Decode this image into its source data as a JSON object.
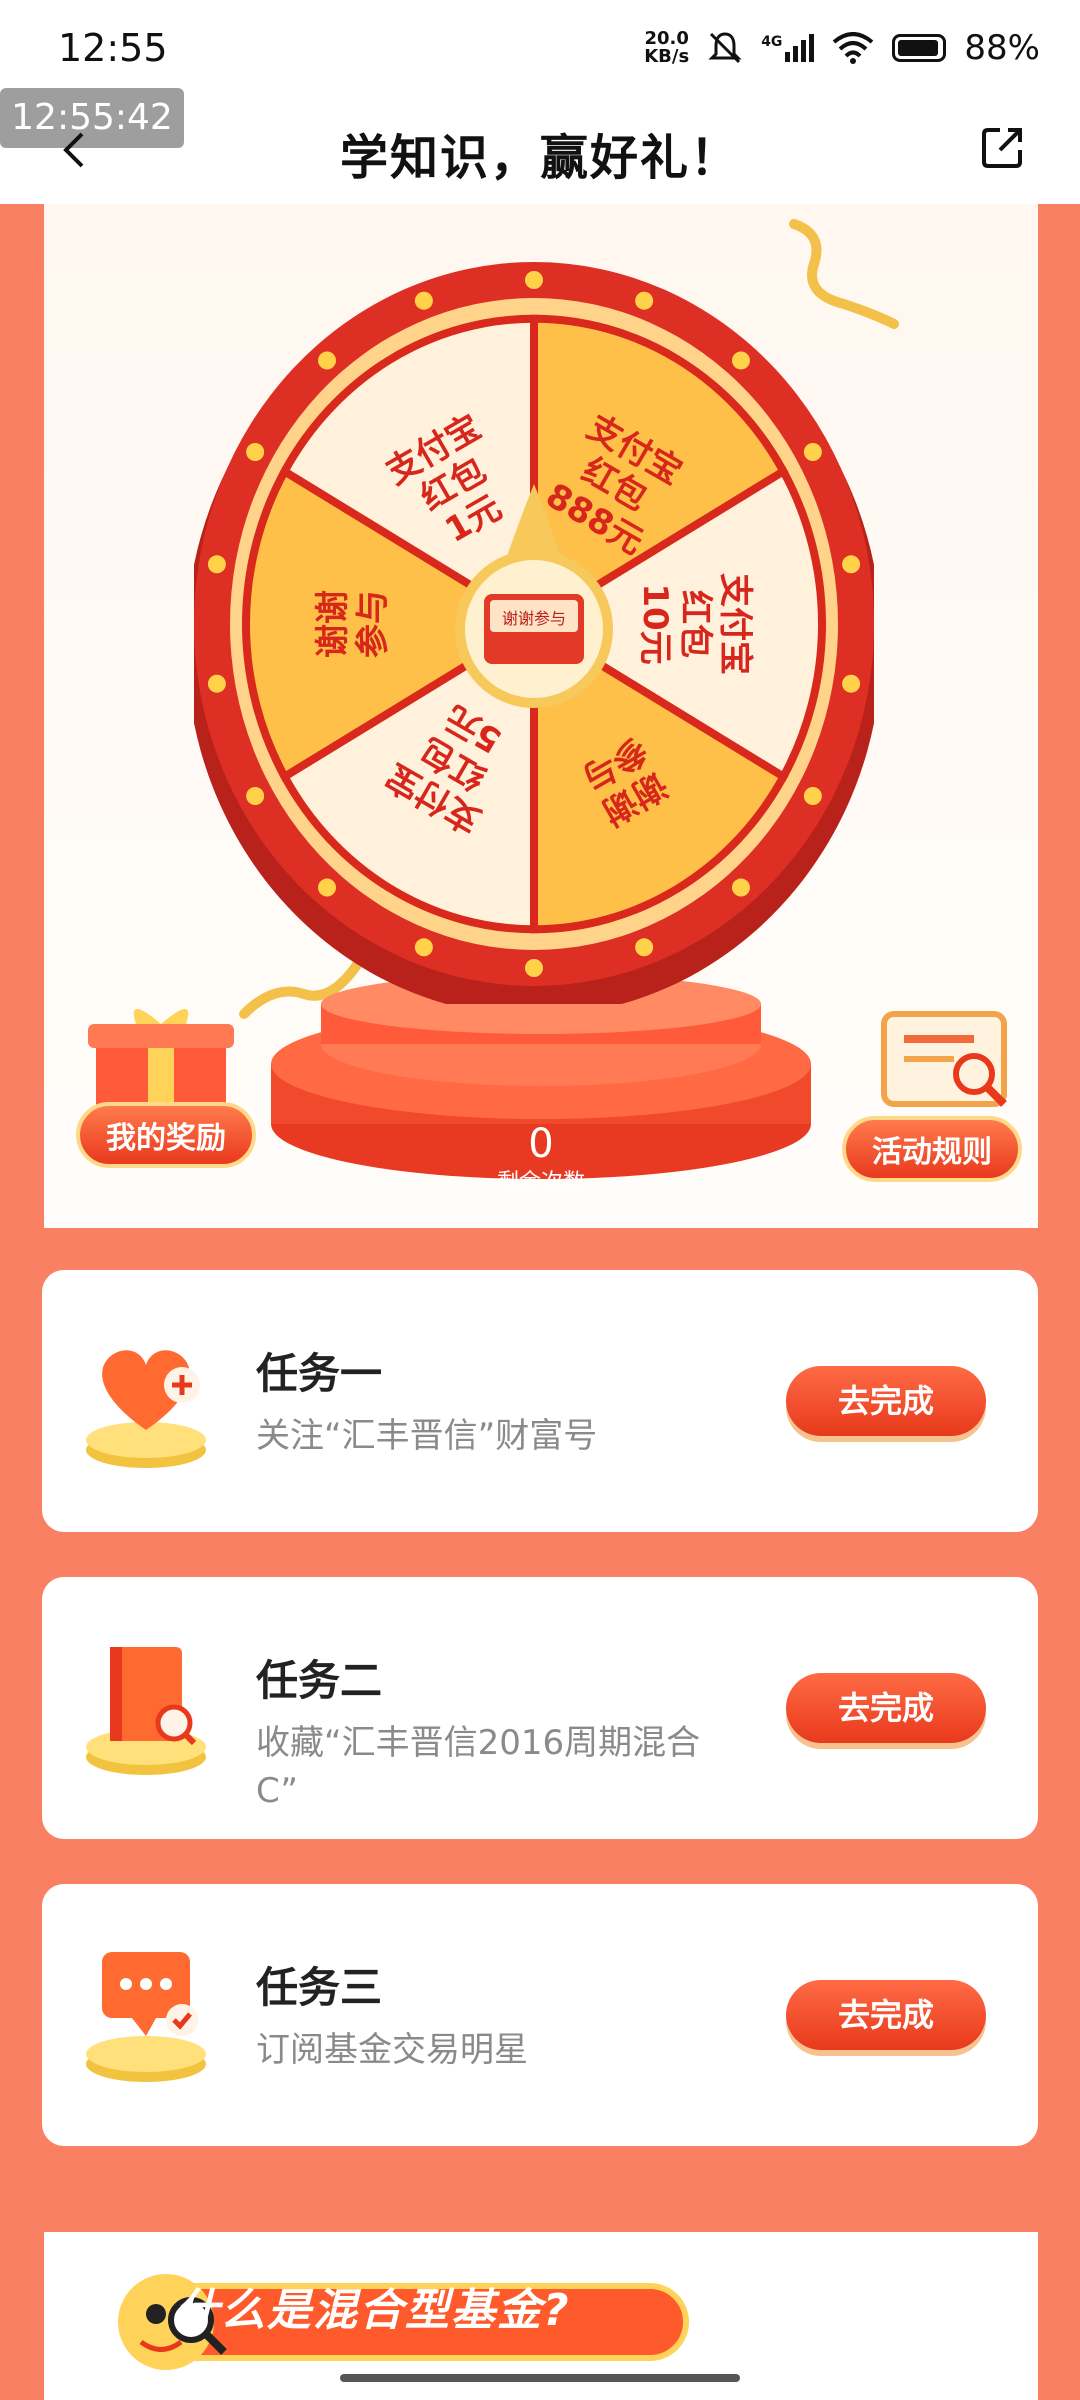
{
  "status_bar": {
    "time": "12:55",
    "net_speed_value": "20.0",
    "net_speed_unit": "KB/s",
    "network": "4G",
    "battery": "88%"
  },
  "overlay_timestamp": "12:55:42",
  "nav": {
    "title": "学知识，赢好礼！"
  },
  "wheel": {
    "center_label": "谢谢参与",
    "segments": [
      {
        "line1": "支付宝",
        "line2": "红包",
        "line3": "888元"
      },
      {
        "line1": "支付宝",
        "line2": "红包",
        "line3": "10元"
      },
      {
        "line1": "谢谢",
        "line2": "参与",
        "line3": ""
      },
      {
        "line1": "支付宝",
        "line2": "红包",
        "line3": "5元"
      },
      {
        "line1": "谢谢",
        "line2": "参与",
        "line3": ""
      },
      {
        "line1": "支付宝",
        "line2": "红包",
        "line3": "1元"
      }
    ],
    "remaining_count": "0",
    "remaining_label": "剩余次数"
  },
  "buttons": {
    "my_rewards": "我的奖励",
    "rules": "活动规则"
  },
  "tasks": [
    {
      "title": "任务一",
      "desc": "关注“汇丰晋信”财富号",
      "button": "去完成"
    },
    {
      "title": "任务二",
      "desc": "收藏“汇丰晋信2016周期混合C”",
      "button": "去完成"
    },
    {
      "title": "任务三",
      "desc": "订阅基金交易明星",
      "button": "去完成"
    }
  ],
  "banner": {
    "text": "什么是混合型基金?"
  }
}
